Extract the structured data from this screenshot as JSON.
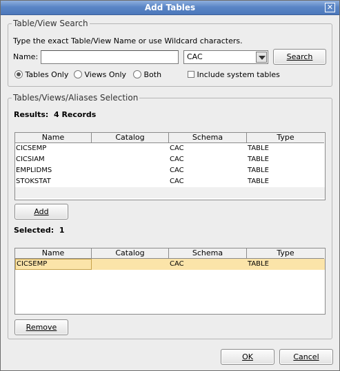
{
  "window": {
    "title": "Add Tables"
  },
  "search": {
    "group_label": "Table/View Search",
    "instructions": "Type the exact Table/View Name or use Wildcard characters.",
    "name_label": "Name:",
    "name_value": "",
    "schema_value": "CAC",
    "search_button": "Search",
    "radio_tables": "Tables Only",
    "radio_views": "Views Only",
    "radio_both": "Both",
    "radio_selected": "Tables Only",
    "include_system": "Include system tables",
    "include_system_checked": false
  },
  "selection": {
    "group_label": "Tables/Views/Aliases Selection",
    "results_label": "Results:",
    "results_count": "4 Records",
    "columns": [
      "Name",
      "Catalog",
      "Schema",
      "Type"
    ],
    "results": [
      {
        "name": "CICSEMP",
        "catalog": "",
        "schema": "CAC",
        "type": "TABLE"
      },
      {
        "name": "CICSIAM",
        "catalog": "",
        "schema": "CAC",
        "type": "TABLE"
      },
      {
        "name": "EMPLIDMS",
        "catalog": "",
        "schema": "CAC",
        "type": "TABLE"
      },
      {
        "name": "STOKSTAT",
        "catalog": "",
        "schema": "CAC",
        "type": "TABLE"
      }
    ],
    "add_button": "Add",
    "selected_label": "Selected:",
    "selected_count": "1",
    "selected": [
      {
        "name": "CICSEMP",
        "catalog": "",
        "schema": "CAC",
        "type": "TABLE"
      }
    ],
    "remove_button": "Remove"
  },
  "footer": {
    "ok_button": "OK",
    "cancel_button": "Cancel"
  }
}
